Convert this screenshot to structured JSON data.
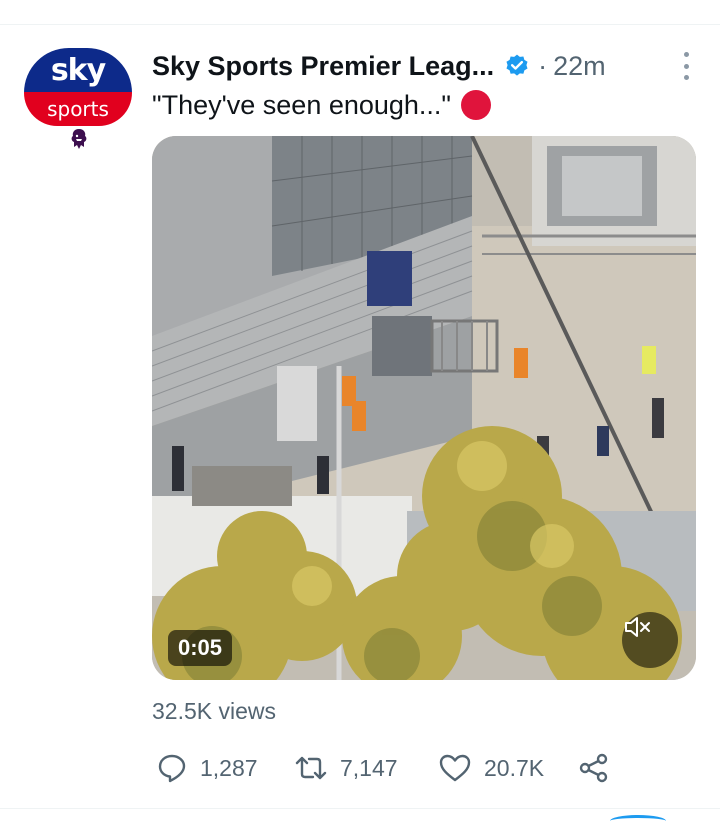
{
  "tweet": {
    "avatar": {
      "brand_top": "sky",
      "brand_bottom": "sports",
      "badge_icon": "premier-league-lion-icon",
      "colors": {
        "top": "#0d2a8a",
        "bottom": "#e1001e"
      }
    },
    "author": {
      "display_name": "Sky Sports Premier Leag...",
      "verified": true,
      "verified_color": "#1d9bf0"
    },
    "separator": "·",
    "time": "22m",
    "text": "\"They've seen enough...\"",
    "emoji": "red-circle",
    "media": {
      "type": "video",
      "duration": "0:05",
      "muted_icon": "speaker-muted-icon"
    },
    "views": "32.5K views",
    "actions": {
      "reply_count": "1,287",
      "retweet_count": "7,147",
      "like_count": "20.7K"
    }
  }
}
